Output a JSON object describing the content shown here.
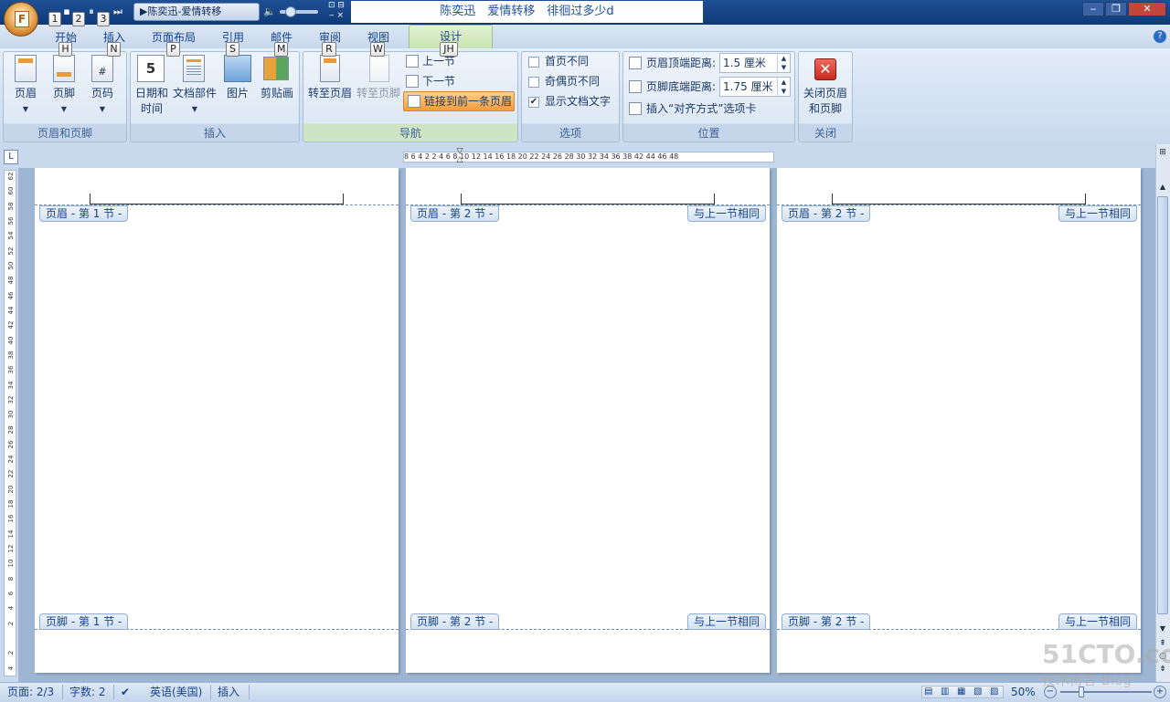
{
  "titlebar": {
    "qa_keys": [
      "1",
      "2",
      "3"
    ],
    "media_title": "▶陈奕迅-爱情转移",
    "doc_title": "陈奕迅　爱情转移　徘徊过多少d",
    "office_letter": "F"
  },
  "tabs": [
    {
      "label": "开始",
      "key": "H"
    },
    {
      "label": "插入",
      "key": "N"
    },
    {
      "label": "页面布局",
      "key": "P"
    },
    {
      "label": "引用",
      "key": "S"
    },
    {
      "label": "邮件",
      "key": "M"
    },
    {
      "label": "审阅",
      "key": "R"
    },
    {
      "label": "视图",
      "key": "W"
    },
    {
      "label": "设计",
      "key": "JH"
    }
  ],
  "ribbon": {
    "groups": {
      "header_footer": {
        "label": "页眉和页脚",
        "buttons": [
          "页眉",
          "页脚",
          "页码"
        ]
      },
      "insert": {
        "label": "插入",
        "buttons": [
          "日期和\n时间",
          "文档部件",
          "图片",
          "剪贴画"
        ]
      },
      "navigation": {
        "label": "导航",
        "goto_header": "转至页眉",
        "goto_footer": "转至页脚",
        "prev": "上一节",
        "next": "下一节",
        "link": "链接到前一条页眉"
      },
      "options": {
        "label": "选项",
        "first_page": "首页不同",
        "odd_even": "奇偶页不同",
        "show_text": "显示文档文字"
      },
      "position": {
        "label": "位置",
        "header_top": "页眉顶端距离:",
        "header_top_val": "1.5 厘米",
        "footer_bottom": "页脚底端距离:",
        "footer_bottom_val": "1.75 厘米",
        "insert_align": "插入“对齐方式”选项卡"
      },
      "close": {
        "label": "关闭",
        "button": "关闭页眉\n和页脚"
      }
    }
  },
  "ruler": {
    "h_ticks": "8  6  4  2     2  4  6  8  10 12 14 16 18 20 22 24 26 28 30 32 34 36 38    42 44 46 48",
    "v_ticks": [
      "62",
      "60",
      "58",
      "56",
      "54",
      "52",
      "50",
      "48",
      "46",
      "44",
      "42",
      "40",
      "38",
      "36",
      "34",
      "32",
      "30",
      "28",
      "26",
      "24",
      "22",
      "20",
      "18",
      "16",
      "14",
      "12",
      "10",
      "8",
      "6",
      "4",
      "2",
      "",
      "2",
      "4"
    ]
  },
  "pages": [
    {
      "header_tag": "页眉 - 第 1 节 -",
      "footer_tag": "页脚 - 第 1 节 -",
      "same_as_prev": ""
    },
    {
      "header_tag": "页眉 - 第 2 节 -",
      "footer_tag": "页脚 - 第 2 节 -",
      "same_as_prev": "与上一节相同"
    },
    {
      "header_tag": "页眉 - 第 2 节 -",
      "footer_tag": "页脚 - 第 2 节 -",
      "same_as_prev": "与上一节相同"
    }
  ],
  "status": {
    "page": "页面: 2/3",
    "words": "字数: 2",
    "language": "英语(美国)",
    "mode": "插入",
    "zoom": "50%"
  },
  "watermark": {
    "main": "51CTO.com",
    "sub": "技术博客  Blog"
  },
  "colors": {
    "title_bar": "#1f4f94",
    "design_tab": "#c7e3b0",
    "link_button": "#f6a543",
    "close_red": "#d9342b"
  }
}
